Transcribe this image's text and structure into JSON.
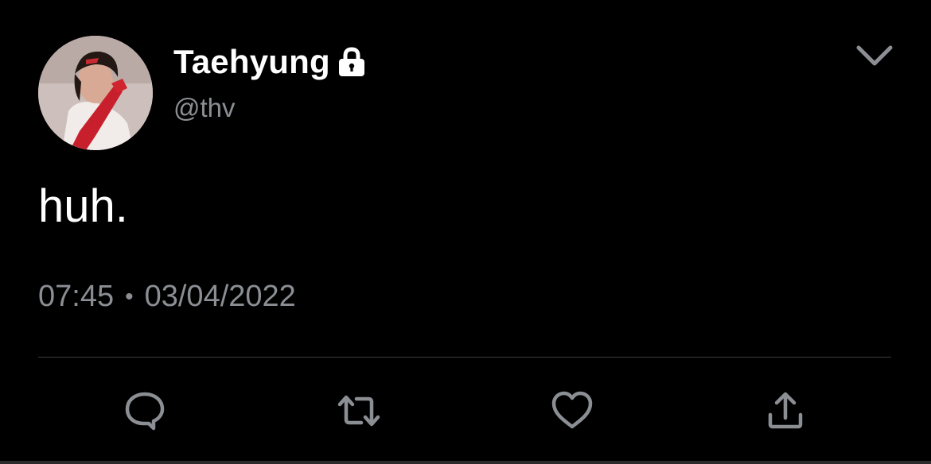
{
  "tweet": {
    "author": {
      "display_name": "Taehyung",
      "handle": "@thv",
      "protected": true,
      "avatar_icon": "profile-photo"
    },
    "text": "huh.",
    "time": "07:45",
    "separator": "•",
    "date": "03/04/2022"
  },
  "actions": [
    {
      "name": "reply",
      "icon": "speech-bubble-icon"
    },
    {
      "name": "retweet",
      "icon": "retweet-arrows-icon"
    },
    {
      "name": "like",
      "icon": "heart-icon"
    },
    {
      "name": "share",
      "icon": "share-upload-icon"
    }
  ],
  "colors": {
    "background": "#000000",
    "primary_text": "#ffffff",
    "secondary_text": "#8b8f94",
    "divider": "#3a3d41"
  }
}
